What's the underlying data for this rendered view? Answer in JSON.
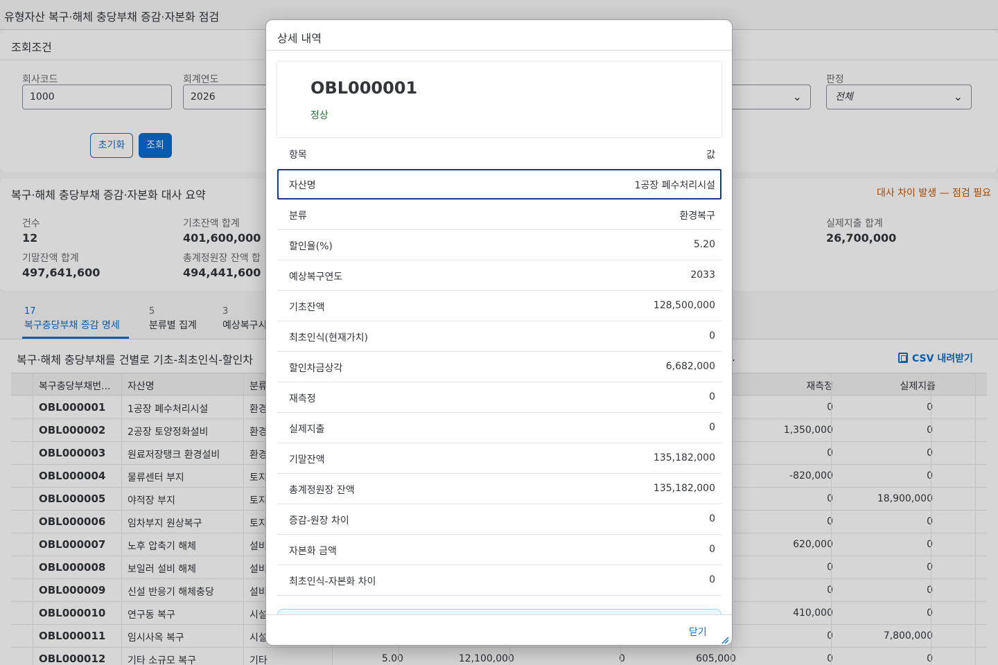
{
  "app": {
    "title": "유형자산 복구·해체 충당부채 증감·자본화 점검"
  },
  "filters": {
    "title": "조회조건",
    "company_label": "회사코드",
    "company_value": "1000",
    "year_label": "회계연도",
    "year_value": "2026",
    "judgement_label": "판정",
    "judgement_value": "전체",
    "reset_label": "초기화",
    "query_label": "조회"
  },
  "summary": {
    "title": "복구·해체 충당부채 증감·자본화 대사 요약",
    "warning": "대사 차이 발생 — 점검 필요",
    "count_label": "건수",
    "count_value": "12",
    "opening_label": "기초잔액 합계",
    "opening_value": "401,600,000",
    "actual_label": "실제지출 합계",
    "actual_value": "26,700,000",
    "closing_label": "기말잔액 합계",
    "closing_value": "497,641,600",
    "gl_label": "총계정원장 잔액 합",
    "gl_value": "494,441,600"
  },
  "tabs": [
    {
      "count": "17",
      "label": "복구충당부채 증감 명세"
    },
    {
      "count": "5",
      "label": "분류별 집계"
    },
    {
      "count": "3",
      "label": "예상복구시"
    }
  ],
  "table": {
    "description": "복구·해체 충당부채를 건별로 기초-최초인식-할인차",
    "description_tail": ".",
    "csv_label": "CSV 내려받기",
    "headers": {
      "no": "복구충당부채번...",
      "name": "자산명",
      "category": "분류",
      "remeasure": "재측정",
      "actual": "실제지출"
    },
    "rows": [
      {
        "no": "OBL000001",
        "name": "1공장 폐수처리시설",
        "category": "환경",
        "rate": "",
        "base": "",
        "initial": "",
        "amort": "",
        "remeasure": "0",
        "actual": "0"
      },
      {
        "no": "OBL000002",
        "name": "2공장 토양정화설비",
        "category": "환경",
        "rate": "",
        "base": "",
        "initial": "",
        "amort": "",
        "remeasure": "1,350,000",
        "actual": "0"
      },
      {
        "no": "OBL000003",
        "name": "원료저장탱크 환경설비",
        "category": "환경",
        "rate": "",
        "base": "",
        "initial": "",
        "amort": "",
        "remeasure": "0",
        "actual": "0"
      },
      {
        "no": "OBL000004",
        "name": "물류센터 부지",
        "category": "토지",
        "rate": "",
        "base": "",
        "initial": "",
        "amort": "",
        "remeasure": "-820,000",
        "actual": "0"
      },
      {
        "no": "OBL000005",
        "name": "야적장 부지",
        "category": "토지",
        "rate": "",
        "base": "",
        "initial": "",
        "amort": "",
        "remeasure": "0",
        "actual": "18,900,000"
      },
      {
        "no": "OBL000006",
        "name": "임차부지 원상복구",
        "category": "토지",
        "rate": "",
        "base": "",
        "initial": "",
        "amort": "",
        "remeasure": "0",
        "actual": "0"
      },
      {
        "no": "OBL000007",
        "name": "노후 압축기 해체",
        "category": "설비",
        "rate": "",
        "base": "",
        "initial": "",
        "amort": "",
        "remeasure": "620,000",
        "actual": "0"
      },
      {
        "no": "OBL000008",
        "name": "보일러 설비 해체",
        "category": "설비",
        "rate": "",
        "base": "",
        "initial": "",
        "amort": "",
        "remeasure": "0",
        "actual": "0"
      },
      {
        "no": "OBL000009",
        "name": "신설 반응기 해체충당",
        "category": "설비",
        "rate": "",
        "base": "",
        "initial": "",
        "amort": "",
        "remeasure": "0",
        "actual": "0"
      },
      {
        "no": "OBL000010",
        "name": "연구동 복구",
        "category": "시설",
        "rate": "",
        "base": "",
        "initial": "",
        "amort": "",
        "remeasure": "410,000",
        "actual": "0"
      },
      {
        "no": "OBL000011",
        "name": "임시사옥 복구",
        "category": "시설",
        "rate": "",
        "base": "",
        "initial": "",
        "amort": "",
        "remeasure": "0",
        "actual": "7,800,000"
      },
      {
        "no": "OBL000012",
        "name": "기타 소규모 복구",
        "category": "기타",
        "rate": "5.00",
        "base": "12,100,000",
        "initial": "0",
        "amort": "605,000",
        "remeasure": "0",
        "actual": "0"
      }
    ]
  },
  "dialog": {
    "title": "상세 내역",
    "object_id": "OBL000001",
    "status": "정상",
    "close_label": "닫기",
    "col_key": "항목",
    "col_value": "값",
    "rows": [
      {
        "key": "자산명",
        "value": "1공장 폐수처리시설"
      },
      {
        "key": "분류",
        "value": "환경복구"
      },
      {
        "key": "할인율(%)",
        "value": "5.20"
      },
      {
        "key": "예상복구연도",
        "value": "2033"
      },
      {
        "key": "기초잔액",
        "value": "128,500,000"
      },
      {
        "key": "최초인식(현재가치)",
        "value": "0"
      },
      {
        "key": "할인차금상각",
        "value": "6,682,000"
      },
      {
        "key": "재측정",
        "value": "0"
      },
      {
        "key": "실제지출",
        "value": "0"
      },
      {
        "key": "기말잔액",
        "value": "135,182,000"
      },
      {
        "key": "총계정원장 잔액",
        "value": "135,182,000"
      },
      {
        "key": "증감-원장 차이",
        "value": "0"
      },
      {
        "key": "자본화 금액",
        "value": "0"
      },
      {
        "key": "최초인식-자본화 차이",
        "value": "0"
      }
    ]
  }
}
